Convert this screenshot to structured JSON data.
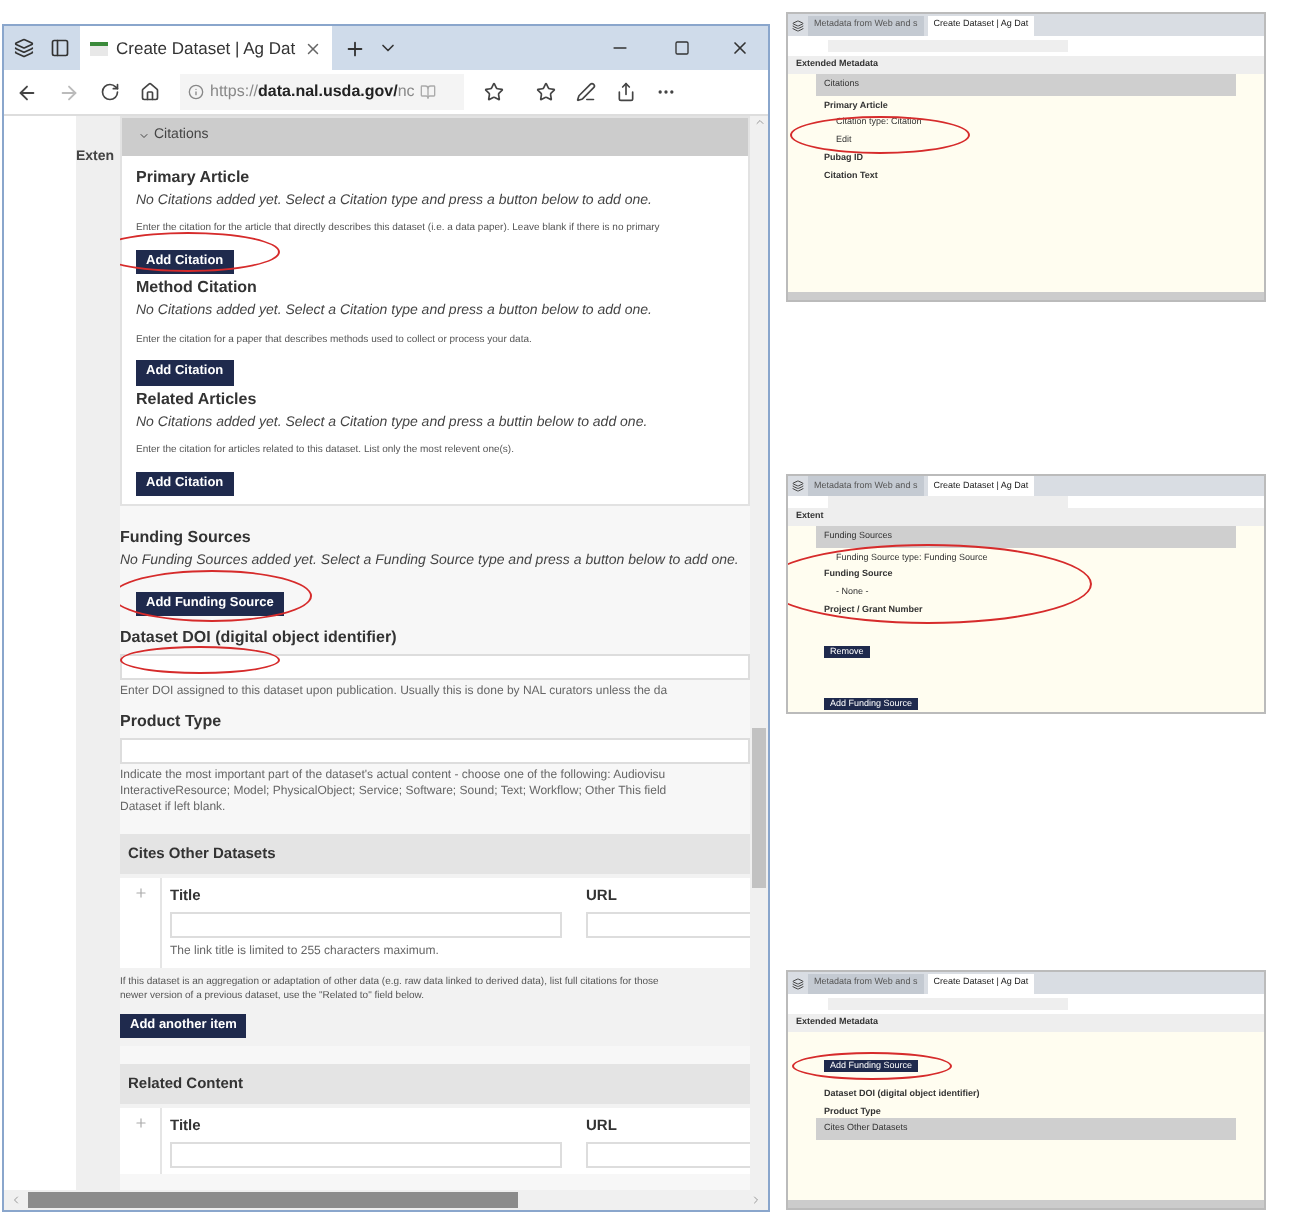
{
  "browser": {
    "tab_title": "Create Dataset | Ag Dat",
    "url_prefix": "https://",
    "url_host": "data.nal.usda.gov/",
    "url_rest": "nc"
  },
  "sidebar_label": "Exten",
  "citations": {
    "header": "Citations",
    "expanded": true,
    "groups": [
      {
        "title": "Primary Article",
        "empty_text": "No Citations added yet. Select a Citation type and press a button below to add one.",
        "help": "Enter the citation for the article that directly describes this dataset (i.e. a data paper). Leave blank if there is no primary",
        "button": "Add Citation",
        "circled": true
      },
      {
        "title": "Method Citation",
        "empty_text": "No Citations added yet. Select a Citation type and press a button below to add one.",
        "help": "Enter the citation for a paper that describes methods used to collect or process your data.",
        "button": "Add Citation",
        "circled": false
      },
      {
        "title": "Related Articles",
        "empty_text": "No Citations added yet. Select a Citation type and press a buttin below to add one.",
        "help": "Enter the citation for articles related to this dataset. List only the most relevent one(s).",
        "button": "Add Citation",
        "circled": false
      }
    ]
  },
  "funding": {
    "title": "Funding Sources",
    "empty_text": "No Funding Sources added yet. Select a Funding Source type and press a button below to add one.",
    "button": "Add Funding Source",
    "circled": true
  },
  "fields": [
    {
      "label": "Dataset DOI (digital object identifier)",
      "help_lines": [
        "Enter DOI assigned to this dataset upon publication. Usually this is done by NAL curators unless the da"
      ],
      "circled": true
    },
    {
      "label": "Product Type",
      "help_lines": [
        "Indicate the most important part of the dataset's actual content - choose one of the following: Audiovisu",
        "InteractiveResource; Model; PhysicalObject; Service; Software; Sound; Text; Workflow; Other This field",
        "Dataset if left blank."
      ],
      "circled": false
    }
  ],
  "tables": [
    {
      "title": "Cites Other Datasets",
      "columns": [
        "Title",
        "URL"
      ],
      "help": "The link title is limited to 255 characters maximum.",
      "note_lines": [
        "If this dataset is an aggregation or adaptation of other data (e.g. raw data linked to derived data), list full citations for those",
        "newer version of a previous dataset, use the \"Related to\" field below."
      ],
      "button": "Add another item"
    },
    {
      "title": "Related Content",
      "columns": [
        "Title",
        "URL"
      ]
    }
  ],
  "thumbnails": [
    {
      "tabs": [
        {
          "label": "Metadata from Web and s",
          "selected": false
        },
        {
          "label": "Create Dataset | Ag Dat",
          "selected": true
        }
      ],
      "lines": [
        {
          "kind": "heading",
          "text": "Extended Metadata"
        },
        {
          "kind": "bar",
          "text": "Citations"
        },
        {
          "kind": "bold",
          "text": "Primary Article"
        },
        {
          "kind": "item",
          "text": "Citation type: Citation"
        },
        {
          "kind": "item",
          "text": "Edit"
        },
        {
          "kind": "bold",
          "text": "Pubag ID"
        },
        {
          "kind": "bold",
          "text": "Citation Text"
        }
      ]
    },
    {
      "tabs": [
        {
          "label": "Metadata from Web and s",
          "selected": false
        },
        {
          "label": "Create Dataset | Ag Dat",
          "selected": true
        }
      ],
      "lines": [
        {
          "kind": "heading",
          "text": "Extent"
        },
        {
          "kind": "bar",
          "text": "Funding Sources"
        },
        {
          "kind": "item",
          "text": "Funding Source type: Funding Source"
        },
        {
          "kind": "bold",
          "text": "Funding Source"
        },
        {
          "kind": "item",
          "text": "- None -"
        },
        {
          "kind": "bold",
          "text": "Project / Grant Number"
        },
        {
          "kind": "button",
          "text": "Remove"
        },
        {
          "kind": "button",
          "text": "Add Funding Source"
        }
      ]
    },
    {
      "tabs": [
        {
          "label": "Metadata from Web and s",
          "selected": false
        },
        {
          "label": "Create Dataset | Ag Dat",
          "selected": true
        }
      ],
      "lines": [
        {
          "kind": "heading",
          "text": "Extended Metadata"
        },
        {
          "kind": "button",
          "text": "Add Funding Source"
        },
        {
          "kind": "bold",
          "text": "Dataset DOI (digital object identifier)"
        },
        {
          "kind": "bold",
          "text": "Product Type"
        },
        {
          "kind": "bar",
          "text": "Cites Other Datasets"
        }
      ]
    }
  ]
}
